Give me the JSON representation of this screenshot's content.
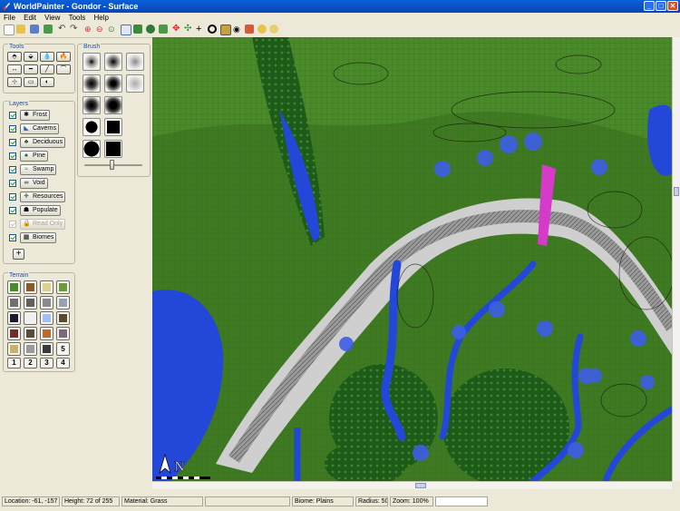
{
  "window": {
    "title": "WorldPainter - Gondor - Surface",
    "minimize": "_",
    "maximize": "□",
    "close": "✕"
  },
  "menu": [
    "File",
    "Edit",
    "View",
    "Tools",
    "Help"
  ],
  "panels": {
    "tools": "Tools",
    "layers": "Layers",
    "brush": "Brush",
    "terrain": "Terrain"
  },
  "tool_glyphs": [
    "⬘",
    "⬙",
    "💧",
    "🔥",
    "↔",
    "━",
    "╱",
    "⌒",
    "⊹",
    "▭",
    "◐"
  ],
  "layers": [
    {
      "label": "Frost",
      "icon": "✱",
      "checked": true,
      "enabled": true
    },
    {
      "label": "Caverns",
      "icon": "◣",
      "checked": true,
      "enabled": true
    },
    {
      "label": "Deciduous",
      "icon": "♣",
      "checked": true,
      "enabled": true
    },
    {
      "label": "Pine",
      "icon": "♠",
      "checked": true,
      "enabled": true
    },
    {
      "label": "Swamp",
      "icon": "≈",
      "checked": true,
      "enabled": true
    },
    {
      "label": "Void",
      "icon": "∞",
      "checked": true,
      "enabled": true
    },
    {
      "label": "Resources",
      "icon": "✚",
      "checked": true,
      "enabled": true
    },
    {
      "label": "Populate",
      "icon": "☗",
      "checked": true,
      "enabled": true
    },
    {
      "label": "Read Only",
      "icon": "🔒",
      "checked": true,
      "enabled": false
    },
    {
      "label": "Biomes",
      "icon": "▦",
      "checked": true,
      "enabled": true
    }
  ],
  "add_layer": "+",
  "terrain_numbers": [
    "5",
    "1",
    "2",
    "3",
    "4"
  ],
  "map": {
    "north_label": "N"
  },
  "status": {
    "location": "Location: -61, -157",
    "height": "Height: 72 of 255",
    "material": "Material: Grass",
    "biome": "Biome: Plains",
    "radius": "Radius: 50",
    "zoom": "Zoom: 100%"
  },
  "colors": {
    "grass": "#3f7a22",
    "water": "#2347d8",
    "forest": "#1f5a1c",
    "accent": "#0a5fd8"
  }
}
